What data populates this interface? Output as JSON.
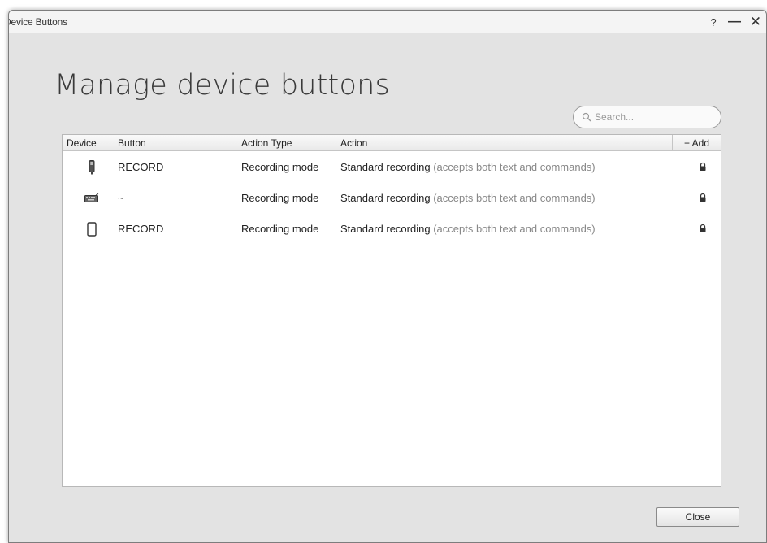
{
  "window": {
    "title": "Device Buttons",
    "help_label": "?",
    "minimize_label": "—",
    "close_label": "✕"
  },
  "page": {
    "heading": "Manage device buttons"
  },
  "search": {
    "placeholder": "Search...",
    "value": "",
    "icon": "magnifier-icon"
  },
  "table": {
    "columns": {
      "device": "Device",
      "button": "Button",
      "action_type": "Action Type",
      "action": "Action",
      "add": "+ Add"
    },
    "rows": [
      {
        "device_icon": "dictation-microphone-icon",
        "button": "RECORD",
        "action_type": "Recording mode",
        "action_main": "Standard recording",
        "action_note": "(accepts both text and commands)",
        "locked": true
      },
      {
        "device_icon": "keyboard-icon",
        "button": "~",
        "action_type": "Recording mode",
        "action_main": "Standard recording",
        "action_note": "(accepts both text and commands)",
        "locked": true
      },
      {
        "device_icon": "mobile-phone-icon",
        "button": "RECORD",
        "action_type": "Recording mode",
        "action_main": "Standard recording",
        "action_note": "(accepts both text and commands)",
        "locked": true
      }
    ]
  },
  "footer": {
    "close_label": "Close"
  }
}
